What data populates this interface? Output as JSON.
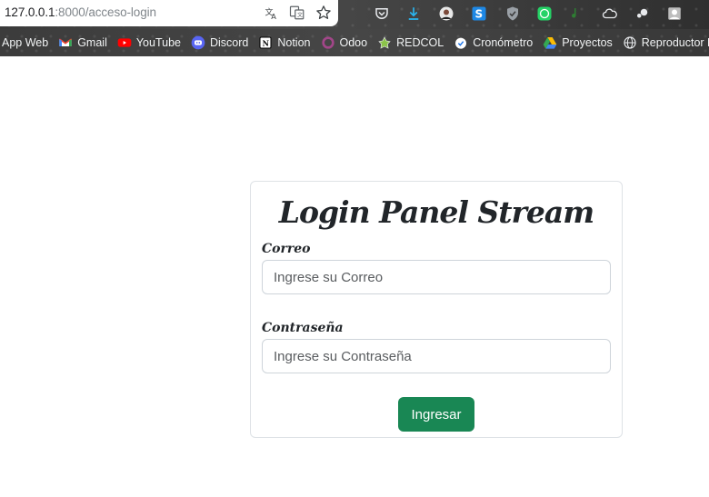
{
  "browser": {
    "url_host": "127.0.0.1",
    "url_rest": ":8000/acceso-login",
    "bookmarks": [
      {
        "label": "App Web",
        "icon": "globe-icon"
      },
      {
        "label": "Gmail",
        "icon": "gmail-icon"
      },
      {
        "label": "YouTube",
        "icon": "youtube-icon"
      },
      {
        "label": "Discord",
        "icon": "discord-icon"
      },
      {
        "label": "Notion",
        "icon": "notion-icon"
      },
      {
        "label": "Odoo",
        "icon": "odoo-icon"
      },
      {
        "label": "REDCOL",
        "icon": "redcol-icon"
      },
      {
        "label": "Cronómetro",
        "icon": "stopwatch-icon"
      },
      {
        "label": "Proyectos",
        "icon": "drive-icon"
      },
      {
        "label": "Reproductor MPD",
        "icon": "globe-icon"
      }
    ]
  },
  "login": {
    "title": "Login Panel Stream",
    "email_label": "Correo",
    "email_placeholder": "Ingrese su Correo",
    "email_value": "",
    "password_label": "Contraseña",
    "password_placeholder": "Ingrese su Contraseña",
    "password_value": "",
    "submit_label": "Ingresar"
  },
  "colors": {
    "submit_button": "#198754",
    "card_border": "#dee2e6",
    "input_border": "#ced4da"
  }
}
